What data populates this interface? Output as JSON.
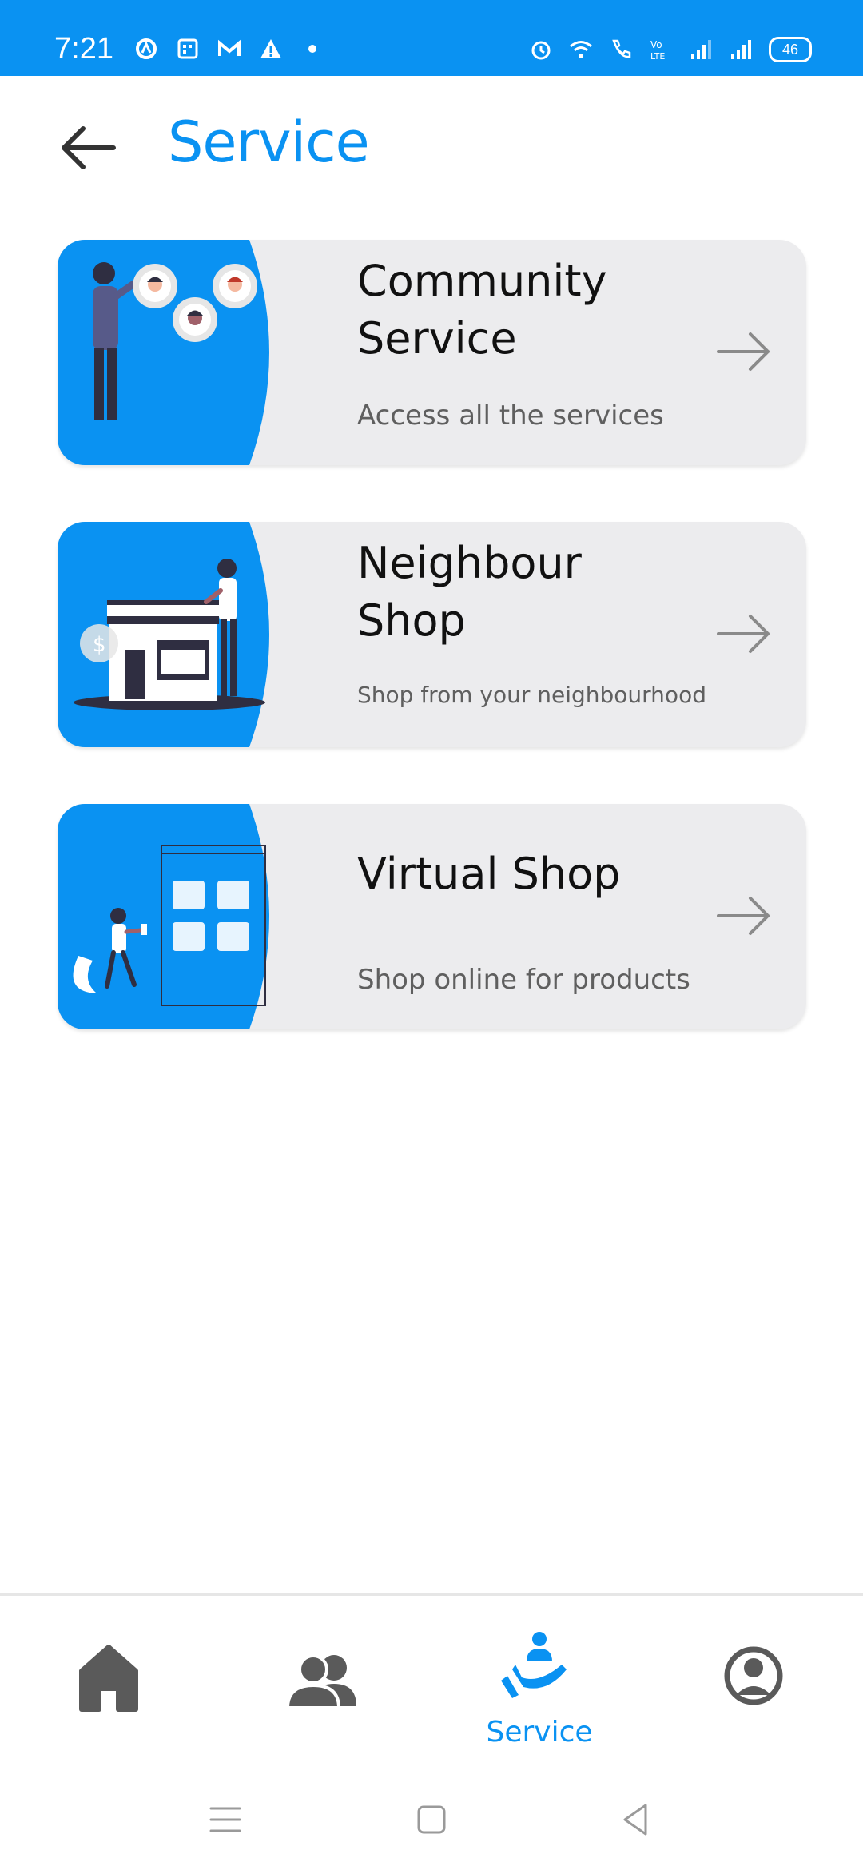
{
  "status_bar": {
    "time": "7:21",
    "battery": "46",
    "left_icons": [
      "app-notification-icon",
      "calendar-icon",
      "gmail-icon",
      "warning-icon",
      "dot-icon"
    ],
    "right_icons": [
      "alarm-icon",
      "wifi-icon",
      "wifi-call-icon",
      "volte-icon",
      "signal-icon",
      "signal-icon"
    ]
  },
  "header": {
    "title": "Service"
  },
  "cards": [
    {
      "title": "Community Service",
      "subtitle": "Access all the services"
    },
    {
      "title": "Neighbour Shop",
      "subtitle": "Shop from your neighbourhood"
    },
    {
      "title": "Virtual Shop",
      "subtitle": "Shop online for products"
    }
  ],
  "bottom_nav": {
    "items": [
      {
        "icon": "home-icon",
        "label": ""
      },
      {
        "icon": "people-icon",
        "label": ""
      },
      {
        "icon": "service-icon",
        "label": "Service",
        "active": true
      },
      {
        "icon": "profile-icon",
        "label": ""
      }
    ]
  },
  "colors": {
    "accent": "#0a92f2",
    "card_bg": "#ececee",
    "dark_icon": "#5a5a5a"
  }
}
